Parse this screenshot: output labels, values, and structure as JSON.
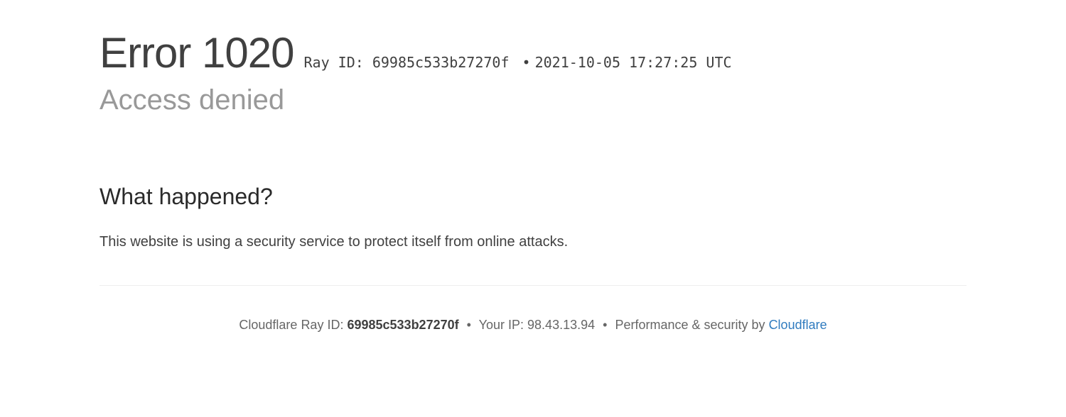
{
  "header": {
    "title": "Error 1020",
    "ray_label": "Ray ID:",
    "ray_id": "69985c533b27270f",
    "timestamp": "2021-10-05 17:27:25 UTC",
    "subtitle": "Access denied"
  },
  "section": {
    "heading": "What happened?",
    "body": "This website is using a security service to protect itself from online attacks."
  },
  "footer": {
    "ray_label": "Cloudflare Ray ID:",
    "ray_id": "69985c533b27270f",
    "ip_label": "Your IP:",
    "ip": "98.43.13.94",
    "perf_label": "Performance & security by",
    "brand": "Cloudflare"
  }
}
